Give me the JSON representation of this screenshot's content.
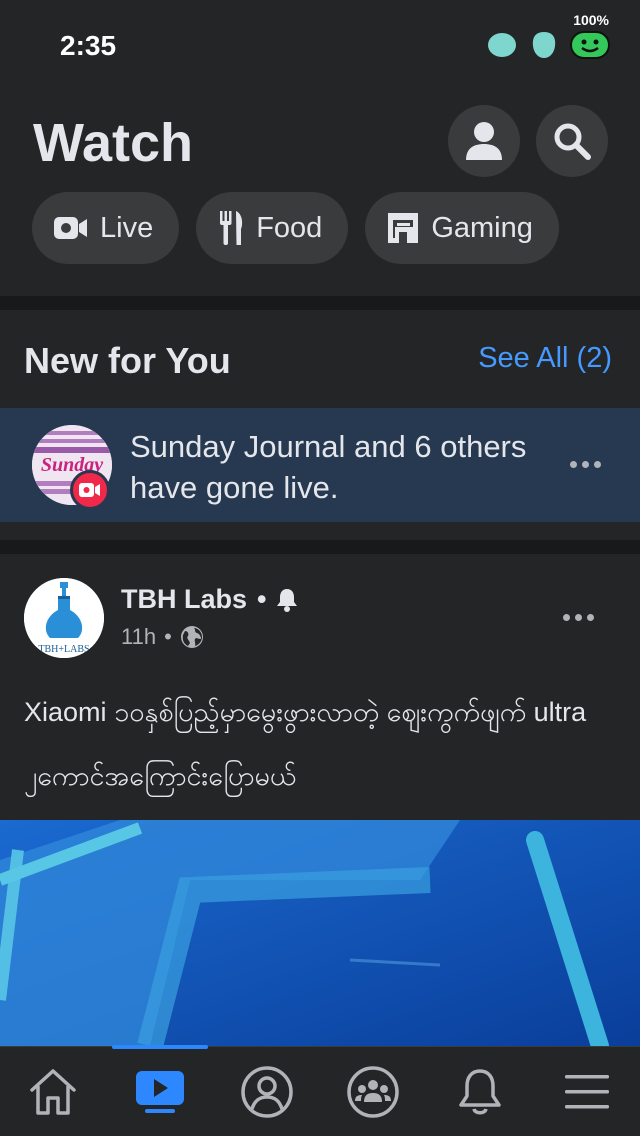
{
  "status_bar": {
    "time": "2:35",
    "battery": "100%",
    "icons": [
      "notification-cyan-icon",
      "notification-teal-icon",
      "notification-green-face-icon"
    ]
  },
  "header": {
    "title": "Watch",
    "profile_icon": "profile-icon",
    "search_icon": "search-icon",
    "chips": [
      {
        "label": "Live",
        "icon": "live-video-icon"
      },
      {
        "label": "Food",
        "icon": "food-utensils-icon"
      },
      {
        "label": "Gaming",
        "icon": "gaming-icon"
      }
    ]
  },
  "new_for_you": {
    "title": "New for You",
    "see_all": "See All (2)",
    "notification": {
      "text": "Sunday Journal and 6 others have gone live.",
      "avatar_logo": "Sunday"
    }
  },
  "post": {
    "author": "TBH Labs",
    "time": "11h",
    "text": "Xiaomi ၁၀နှစ်ပြည့်မှာမွေးဖွားလာတဲ့ ဈေးကွက်ဖျက် ultra ၂ကောင်အကြောင်းပြောမယ်",
    "avatar_logo": "TBH+LABS"
  },
  "bottom_nav": {
    "items": [
      "home-icon",
      "watch-icon",
      "profile-icon",
      "groups-icon",
      "notifications-icon",
      "menu-icon"
    ],
    "active": "watch-icon"
  },
  "colors": {
    "background": "#242526",
    "accent": "#2d88ff",
    "link": "#4599ff",
    "notification_bg": "#263951",
    "live_red": "#f02849"
  }
}
